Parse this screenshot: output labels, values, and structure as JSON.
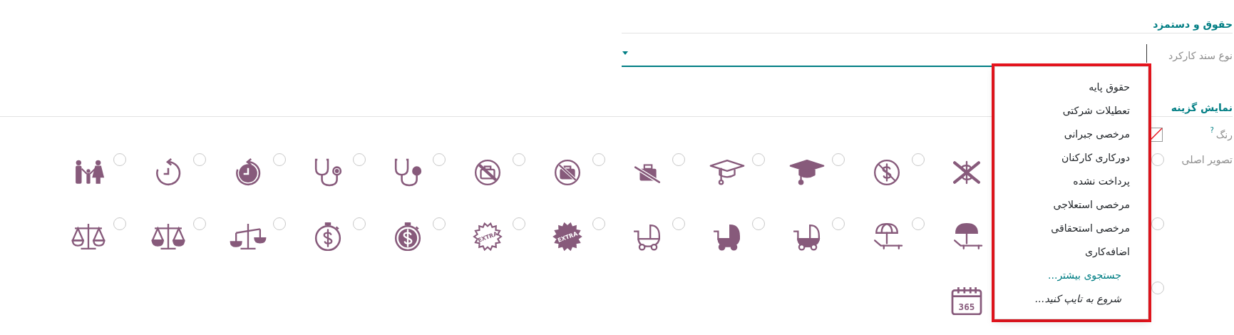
{
  "payroll_section": {
    "title": "حقوق و دستمزد",
    "field": {
      "label": "نوع سند کارکرد"
    }
  },
  "dropdown": {
    "items": [
      "حقوق پایه",
      "تعطیلات شرکتی",
      "مرخصی جبرانی",
      "دورکاری کارکنان",
      "پرداخت نشده",
      "مرخصی استعلاجی",
      "مرخصی استحقاقی",
      "اضافه‌کاری"
    ],
    "search_more": "جستجوی بیشتر...",
    "hint": "شروع به تایپ کنید..."
  },
  "display_section": {
    "title": "نمایش گزینه",
    "color_label": "رنگ",
    "help_mark": "?",
    "image_label": "تصویر اصلی",
    "icon_rows": [
      [
        {
          "kind": "covered",
          "selected": false
        },
        {
          "kind": "gap"
        },
        {
          "kind": "dollar-cross"
        },
        {
          "kind": "no-dollar",
          "selected": false
        },
        {
          "kind": "cap-filled",
          "selected": false
        },
        {
          "kind": "cap",
          "selected": false
        },
        {
          "kind": "briefcase-slash",
          "selected": false
        },
        {
          "kind": "no-briefcase-filled",
          "selected": false
        },
        {
          "kind": "no-briefcase",
          "selected": false
        },
        {
          "kind": "stethoscope-filled",
          "selected": false
        },
        {
          "kind": "stethoscope",
          "selected": false
        },
        {
          "kind": "history-filled",
          "selected": false
        },
        {
          "kind": "history",
          "selected": false
        },
        {
          "kind": "family",
          "selected": false
        }
      ],
      [
        {
          "kind": "covered",
          "selected": false
        },
        {
          "kind": "gap"
        },
        {
          "kind": "umbrella-filled"
        },
        {
          "kind": "umbrella",
          "selected": false
        },
        {
          "kind": "stroller-half",
          "selected": false
        },
        {
          "kind": "stroller-filled",
          "selected": false
        },
        {
          "kind": "stroller",
          "selected": false
        },
        {
          "kind": "starburst-filled",
          "label": "EXTRA",
          "selected": false
        },
        {
          "kind": "starburst",
          "label": "EXTRA",
          "selected": false
        },
        {
          "kind": "timer-filled",
          "selected": false
        },
        {
          "kind": "timer",
          "selected": false
        },
        {
          "kind": "scales-tilted",
          "selected": false
        },
        {
          "kind": "scales-filled",
          "selected": false
        },
        {
          "kind": "scales",
          "selected": false
        }
      ],
      [
        {
          "kind": "covered",
          "selected": false
        },
        {
          "kind": "gap"
        },
        {
          "kind": "calendar",
          "label": "365"
        }
      ]
    ]
  }
}
